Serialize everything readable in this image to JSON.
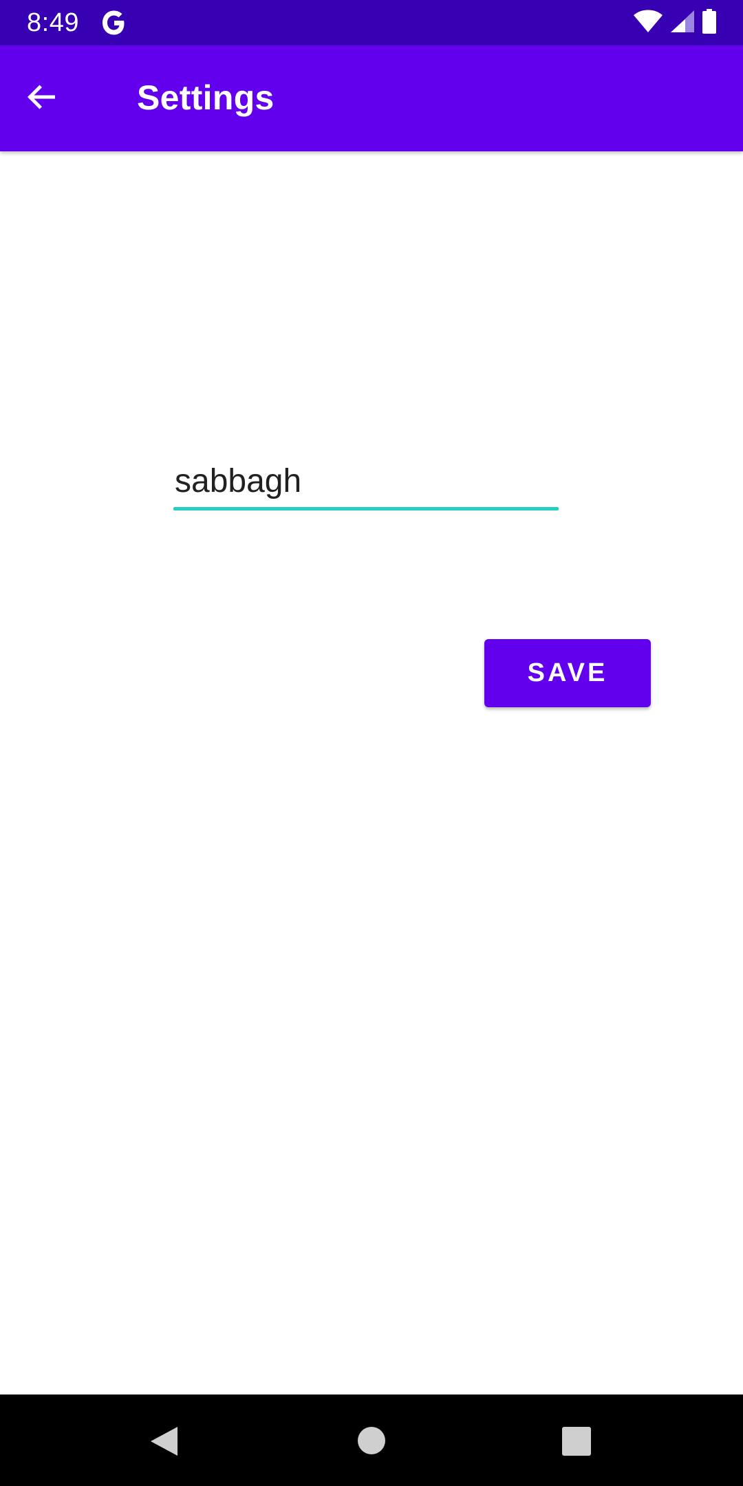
{
  "status_bar": {
    "time": "8:49",
    "notification_icon": "google-g-icon",
    "icons": [
      "wifi-icon",
      "cellular-signal-icon",
      "battery-icon"
    ]
  },
  "app_bar": {
    "title": "Settings",
    "back_icon": "arrow-back-icon"
  },
  "form": {
    "name_value": "sabbagh",
    "save_label": "SAVE"
  },
  "nav_bar": {
    "buttons": [
      "back-triangle-icon",
      "home-circle-icon",
      "recents-square-icon"
    ]
  },
  "colors": {
    "status_bar": "#3700b3",
    "primary": "#6200ee",
    "accent_underline": "#26d0c0",
    "text": "#212121",
    "nav_bar": "#000000"
  }
}
